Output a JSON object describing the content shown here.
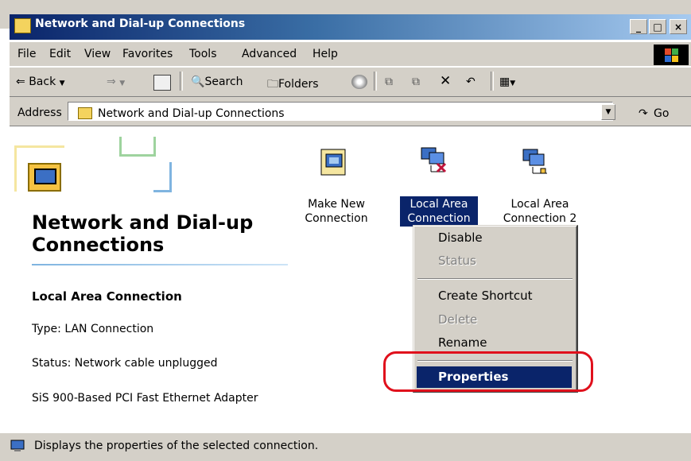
{
  "window": {
    "title": "Network and Dial-up Connections",
    "controls": {
      "minimize": "_",
      "maximize": "□",
      "close": "×"
    }
  },
  "menubar": {
    "items": [
      "File",
      "Edit",
      "View",
      "Favorites",
      "Tools",
      "Advanced",
      "Help"
    ]
  },
  "toolbar": {
    "back": "Back",
    "search": "Search",
    "folders": "Folders"
  },
  "address": {
    "label": "Address",
    "value": "Network and Dial-up Connections",
    "go": "Go"
  },
  "left_panel": {
    "title": "Network and Dial-up Connections",
    "selected_name": "Local Area Connection",
    "type": "Type: LAN Connection",
    "status": "Status: Network cable unplugged",
    "adapter": "SiS 900-Based PCI Fast Ethernet Adapter"
  },
  "icons": [
    {
      "label_line1": "Make New",
      "label_line2": "Connection",
      "icon": "make-new-connection-icon"
    },
    {
      "label_line1": "Local Area",
      "label_line2": "Connection",
      "icon": "network-disconnected-icon",
      "selected": true
    },
    {
      "label_line1": "Local Area",
      "label_line2": "Connection 2",
      "icon": "network-connection-icon"
    }
  ],
  "context_menu": {
    "items": [
      {
        "label": "Disable",
        "enabled": true
      },
      {
        "label": "Status",
        "enabled": false
      },
      {
        "label": "Create Shortcut",
        "enabled": true
      },
      {
        "label": "Delete",
        "enabled": false
      },
      {
        "label": "Rename",
        "enabled": true
      },
      {
        "label": "Properties",
        "enabled": true,
        "highlighted": true
      }
    ]
  },
  "statusbar": {
    "text": "Displays the properties of the selected connection."
  },
  "colors": {
    "titlebar": "#0a246a",
    "selection": "#0a246a",
    "face": "#d4d0c8",
    "annotation": "#e0101c"
  }
}
